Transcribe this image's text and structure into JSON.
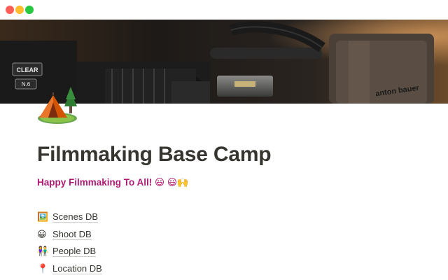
{
  "window": {
    "controls": [
      "close",
      "minimize",
      "zoom"
    ]
  },
  "cover": {
    "image": "cinema-camera-photo",
    "camera_text": [
      "CLEAR",
      "N.6",
      "anton bauer"
    ]
  },
  "page": {
    "icon": "camping-tent-icon",
    "title": "Filmmaking Base Camp",
    "subtitle": "Happy Filmmaking To All!",
    "subtitle_emojis": "😃 😃🙌",
    "subtitle_color": "#ad1a72"
  },
  "links": [
    {
      "emoji": "🖼️",
      "label": "Scenes DB"
    },
    {
      "emoji": "😀",
      "label": "Shoot DB"
    },
    {
      "emoji": "👫",
      "label": "People DB"
    },
    {
      "emoji": "📍",
      "label": "Location DB"
    }
  ]
}
